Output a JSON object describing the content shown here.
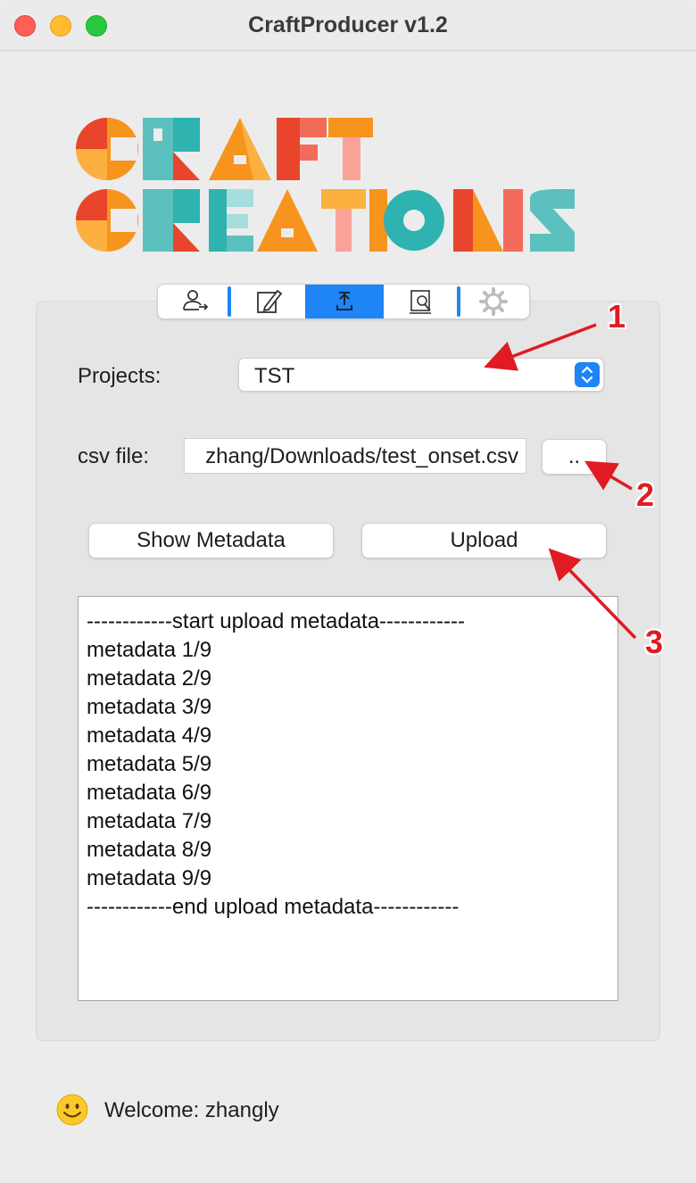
{
  "window": {
    "title": "CraftProducer v1.2"
  },
  "logo": {
    "line1": "CRAFT",
    "line2": "CREATIONS"
  },
  "tabs": [
    {
      "icon": "user-transfer-icon",
      "active": false
    },
    {
      "icon": "edit-icon",
      "active": false
    },
    {
      "icon": "upload-icon",
      "active": true
    },
    {
      "icon": "inspect-document-icon",
      "active": false
    },
    {
      "icon": "gear-icon",
      "active": false
    }
  ],
  "projects": {
    "label": "Projects:",
    "selected": "TST"
  },
  "csv": {
    "label": "csv file:",
    "value": "zhang/Downloads/test_onset.csv",
    "browse_label": ".."
  },
  "actions": {
    "show_metadata_label": "Show Metadata",
    "upload_label": "Upload"
  },
  "log": {
    "lines": [
      "------------start upload metadata------------",
      "metadata 1/9",
      "metadata 2/9",
      "metadata 3/9",
      "metadata 4/9",
      "metadata 5/9",
      "metadata 6/9",
      "metadata 7/9",
      "metadata 8/9",
      "metadata 9/9",
      "------------end upload metadata------------"
    ]
  },
  "status": {
    "icon": "smiley-icon",
    "welcome": "Welcome: zhangly"
  },
  "annotations": [
    "1",
    "2",
    "3"
  ],
  "colors": {
    "accent": "#1f84f6",
    "annotation": "#e01b22"
  }
}
